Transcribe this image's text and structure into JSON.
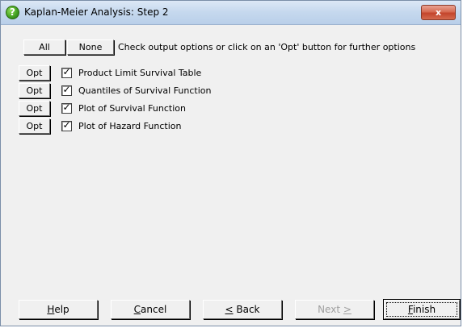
{
  "window": {
    "title": "Kaplan-Meier Analysis: Step 2",
    "close_label": "x"
  },
  "header": {
    "all_label": "All",
    "none_label": "None",
    "instruction": "Check output options or click on an 'Opt' button for further options"
  },
  "options": [
    {
      "opt_label": "Opt",
      "label": "Product Limit Survival Table",
      "checked": true
    },
    {
      "opt_label": "Opt",
      "label": "Quantiles of Survival Function",
      "checked": true
    },
    {
      "opt_label": "Opt",
      "label": "Plot of Survival Function",
      "checked": true
    },
    {
      "opt_label": "Opt",
      "label": "Plot of Hazard Function",
      "checked": true
    }
  ],
  "footer": {
    "help": {
      "accel": "H",
      "rest": "elp"
    },
    "cancel": {
      "accel": "C",
      "rest": "ancel"
    },
    "back": {
      "accel": "<",
      "rest": " Back"
    },
    "next": {
      "pre": "Next ",
      "accel": ">"
    },
    "finish": {
      "accel": "F",
      "rest": "inish"
    }
  },
  "colors": {
    "dialog_bg": "#f0f0f0",
    "title_bar": "#c5d8ee",
    "close_button": "#c4452c"
  }
}
